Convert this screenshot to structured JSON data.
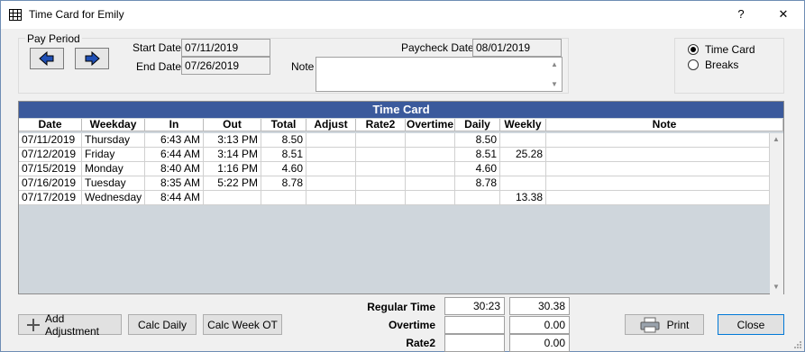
{
  "window": {
    "title": "Time Card for Emily",
    "help_label": "?",
    "close_label": "✕"
  },
  "pay_period": {
    "legend": "Pay Period",
    "start_label": "Start Date",
    "start_value": "07/11/2019",
    "end_label": "End Date",
    "end_value": "07/26/2019",
    "paycheck_label": "Paycheck Date",
    "paycheck_value": "08/01/2019",
    "note_label": "Note",
    "note_value": ""
  },
  "view_options": {
    "time_card_label": "Time Card",
    "breaks_label": "Breaks",
    "selected": "Time Card"
  },
  "grid": {
    "title": "Time Card",
    "columns": [
      "Date",
      "Weekday",
      "In",
      "Out",
      "Total",
      "Adjust",
      "Rate2",
      "Overtime",
      "Daily",
      "Weekly",
      "Note"
    ],
    "rows": [
      [
        "07/11/2019",
        "Thursday",
        "6:43 AM",
        "3:13 PM",
        "8.50",
        "",
        "",
        "",
        "8.50",
        "",
        ""
      ],
      [
        "07/12/2019",
        "Friday",
        "6:44 AM",
        "3:14 PM",
        "8.51",
        "",
        "",
        "",
        "8.51",
        "25.28",
        ""
      ],
      [
        "07/15/2019",
        "Monday",
        "8:40 AM",
        "1:16 PM",
        "4.60",
        "",
        "",
        "",
        "4.60",
        "",
        ""
      ],
      [
        "07/16/2019",
        "Tuesday",
        "8:35 AM",
        "5:22 PM",
        "8.78",
        "",
        "",
        "",
        "8.78",
        "",
        ""
      ],
      [
        "07/17/2019",
        "Wednesday",
        "8:44 AM",
        "",
        "",
        "",
        "",
        "",
        "",
        "13.38",
        ""
      ]
    ]
  },
  "totals": {
    "regular_label": "Regular Time",
    "regular_hm": "30:23",
    "regular_dec": "30.38",
    "overtime_label": "Overtime",
    "overtime_hm": "",
    "overtime_dec": "0.00",
    "rate2_label": "Rate2",
    "rate2_hm": "",
    "rate2_dec": "0.00"
  },
  "buttons": {
    "add_adjustment": "Add Adjustment",
    "calc_daily": "Calc Daily",
    "calc_week_ot": "Calc Week OT",
    "print": "Print",
    "close": "Close"
  }
}
